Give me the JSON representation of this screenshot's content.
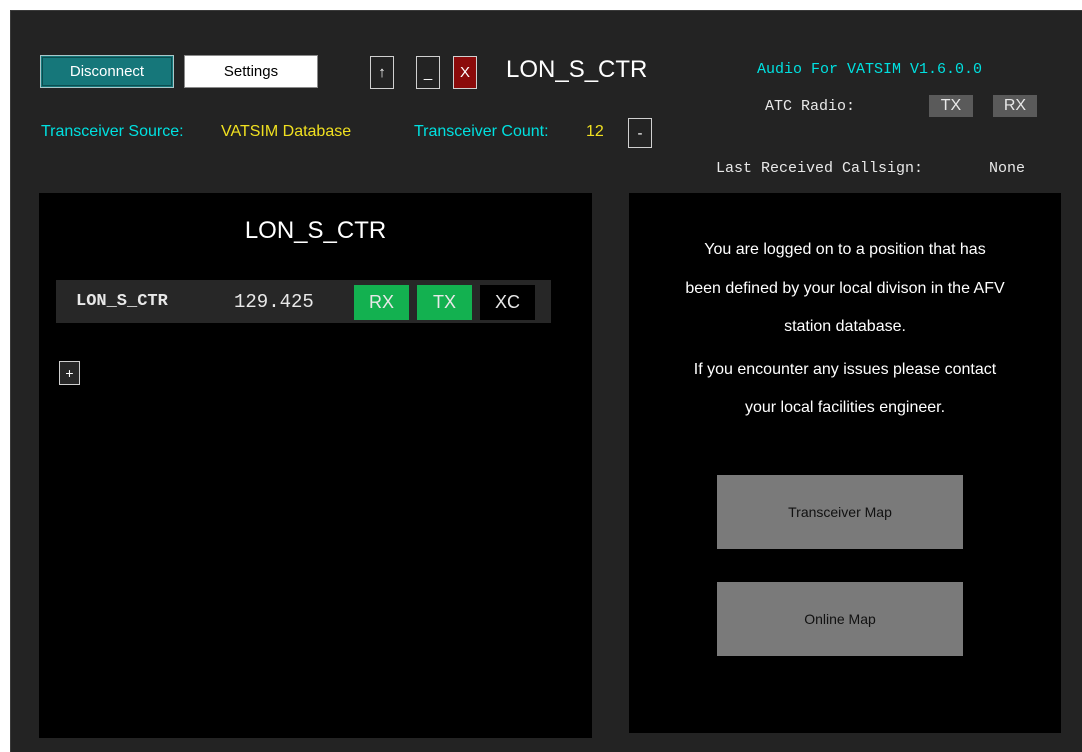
{
  "toolbar": {
    "disconnect_label": "Disconnect",
    "settings_label": "Settings",
    "up_label": "↑",
    "minimize_label": "_",
    "close_label": "X",
    "callsign": "LON_S_CTR"
  },
  "header": {
    "version": "Audio For VATSIM V1.6.0.0",
    "atc_radio_label": "ATC Radio:",
    "atc_tx": "TX",
    "atc_rx": "RX",
    "transceiver_source_label": "Transceiver Source:",
    "transceiver_source_value": "VATSIM Database",
    "transceiver_count_label": "Transceiver Count:",
    "transceiver_count_value": "12",
    "collapse_label": "-",
    "last_received_label": "Last Received Callsign:",
    "last_received_value": "None"
  },
  "stations": {
    "title": "LON_S_CTR",
    "rows": [
      {
        "callsign": "LON_S_CTR",
        "frequency": "129.425",
        "rx": "RX",
        "tx": "TX",
        "xc": "XC"
      }
    ],
    "add_label": "+"
  },
  "info": {
    "line1": "You are logged on to a position that has",
    "line2": "been defined by your local divison in the AFV",
    "line3": "station database.",
    "line4": "If you encounter any issues please contact",
    "line5": "your local facilities engineer.",
    "transceiver_map_label": "Transceiver Map",
    "online_map_label": "Online Map"
  },
  "colors": {
    "background": "#232323",
    "accent_teal": "#16777a",
    "close_red": "#8b0b0b",
    "active_green": "#13b150",
    "cyan_text": "#00e0e0",
    "yellow_text": "#f0e020"
  }
}
